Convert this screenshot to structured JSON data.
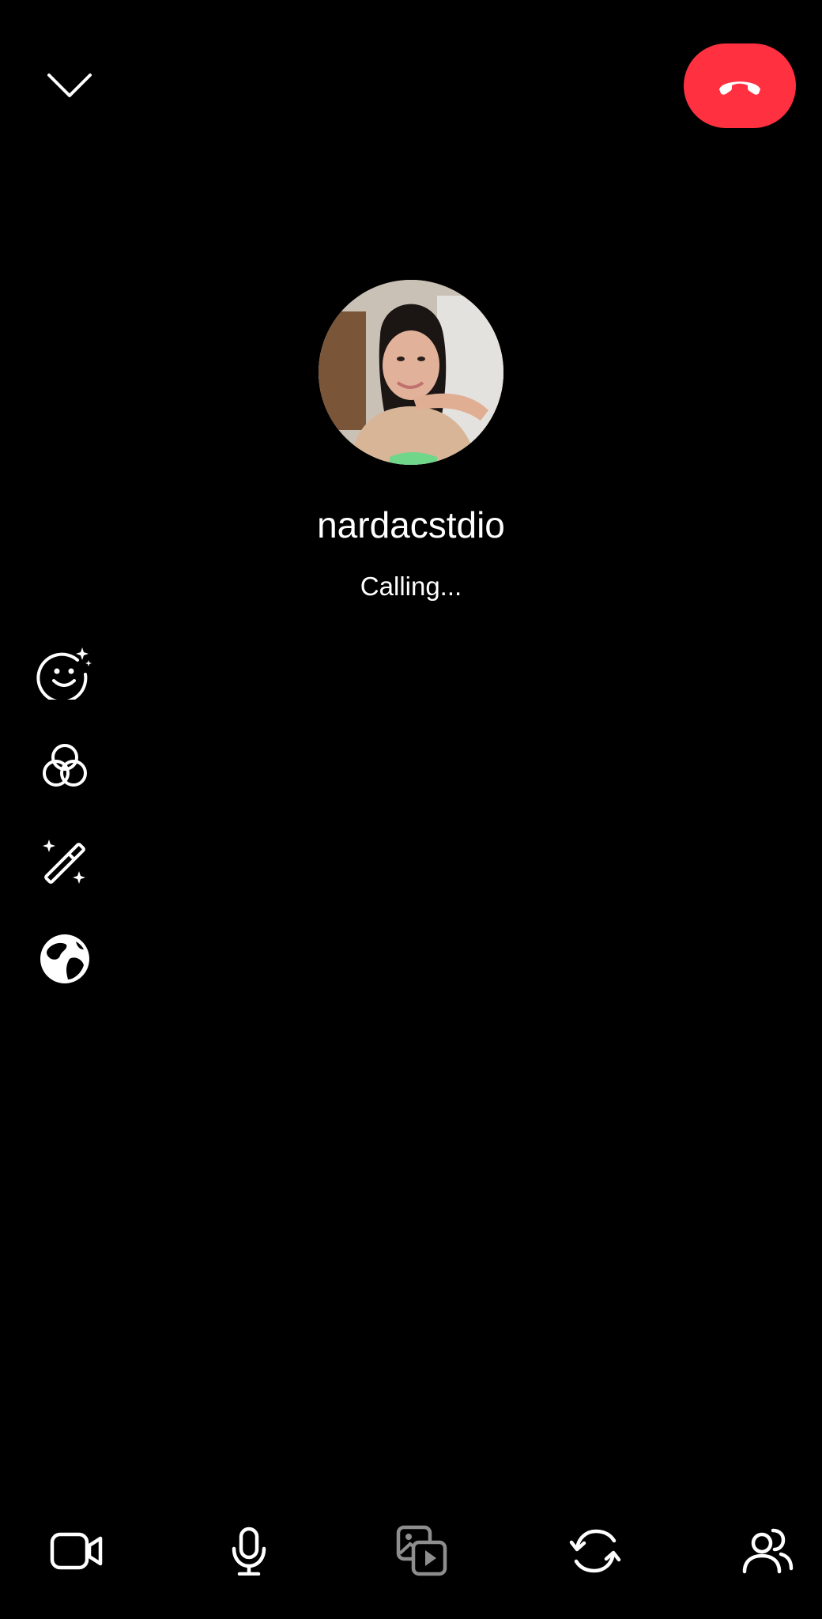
{
  "caller": {
    "name": "nardacstdio",
    "status": "Calling..."
  },
  "colors": {
    "background": "#000000",
    "end_call": "#ff3040",
    "icon": "#ffffff",
    "icon_disabled": "#8e8e8e"
  },
  "top_bar": {
    "minimize_icon": "chevron-down-icon",
    "end_call_icon": "phone-hangup-icon"
  },
  "effects_toolbar": [
    {
      "id": "face-effects",
      "icon": "face-sparkle-icon"
    },
    {
      "id": "filters",
      "icon": "filters-icon"
    },
    {
      "id": "magic",
      "icon": "magic-wand-icon"
    },
    {
      "id": "backgrounds",
      "icon": "globe-icon"
    }
  ],
  "bottom_controls": [
    {
      "id": "video",
      "icon": "video-camera-icon",
      "enabled": true
    },
    {
      "id": "microphone",
      "icon": "microphone-icon",
      "enabled": true
    },
    {
      "id": "share-media",
      "icon": "media-share-icon",
      "enabled": false
    },
    {
      "id": "flip-camera",
      "icon": "flip-camera-icon",
      "enabled": true
    },
    {
      "id": "add-people",
      "icon": "add-people-icon",
      "enabled": true
    }
  ]
}
